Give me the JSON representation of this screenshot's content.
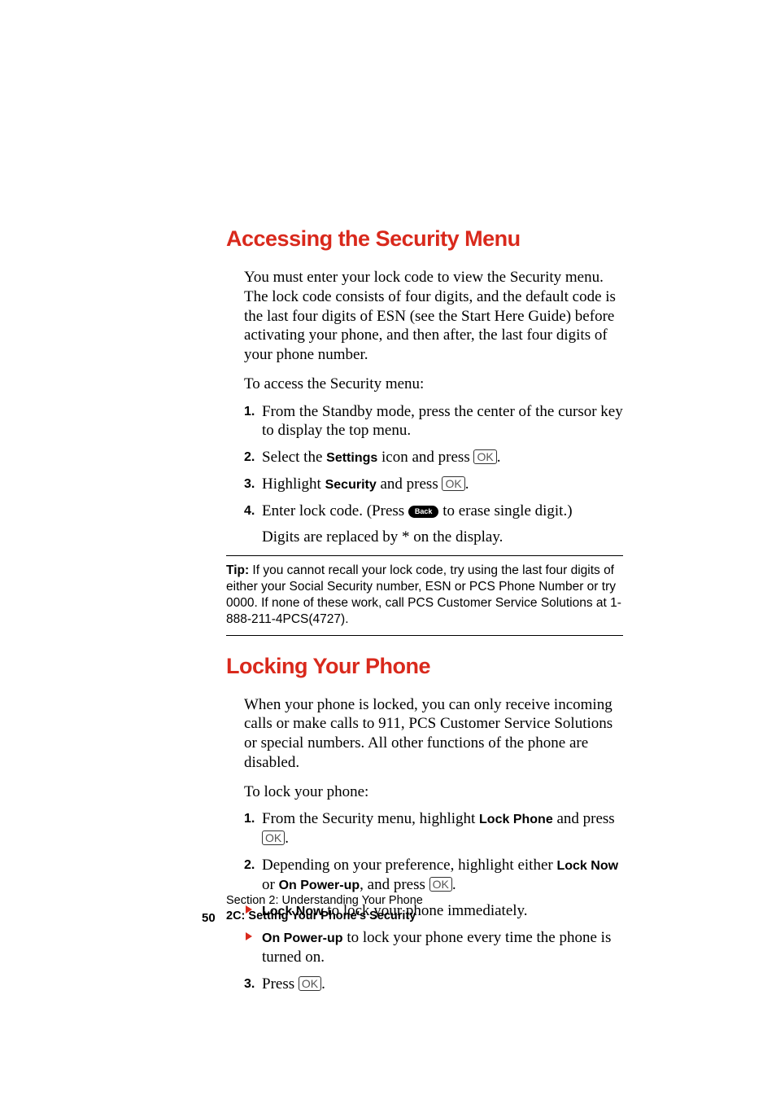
{
  "section1": {
    "heading": "Accessing the Security Menu",
    "para1": "You must enter your lock code to view the Security menu. The lock code consists of four digits, and the default code is the last four digits of ESN (see the Start Here Guide) before activating your phone, and then after, the last four digits of your phone number.",
    "intro": "To access the Security menu:",
    "steps": {
      "s1": "From the Standby mode, press the center of the cursor key to display the top menu.",
      "s2a": "Select the ",
      "s2b": "Settings",
      "s2c": " icon and press ",
      "s3a": "Highlight ",
      "s3b": "Security",
      "s3c": " and press ",
      "s4a": "Enter lock code. (Press ",
      "s4b": " to erase single digit.)"
    },
    "note": "Digits are replaced by * on the display.",
    "keys": {
      "ok": "OK",
      "back": "Back"
    }
  },
  "tip": {
    "label": "Tip:",
    "text": " If you cannot recall your lock code, try using the last four digits of either your Social Security number, ESN or PCS Phone Number or try 0000. If none of these work, call PCS Customer Service Solutions at 1-888-211-4PCS(4727)."
  },
  "section2": {
    "heading": "Locking Your Phone",
    "para1": "When your phone is locked, you can only receive incoming calls or make calls to 911, PCS Customer Service Solutions or special numbers. All other functions of the phone are disabled.",
    "intro": "To lock your phone:",
    "steps": {
      "s1a": "From the Security menu, highlight ",
      "s1b": "Lock Phone",
      "s1c": " and press ",
      "s2a": "Depending on your preference, highlight either ",
      "s2b": "Lock Now",
      "s2c": " or ",
      "s2d": "On Power-up",
      "s2e": ", and press ",
      "b1a": "Lock Now",
      "b1b": " to lock your phone immediately.",
      "b2a": "On Power-up",
      "b2b": " to lock your phone every time the phone is turned on.",
      "s3a": "Press "
    }
  },
  "footer": {
    "line1": "Section 2: Understanding Your Phone",
    "line2": "2C: Setting Your Phone's Security",
    "pagenum": "50"
  }
}
